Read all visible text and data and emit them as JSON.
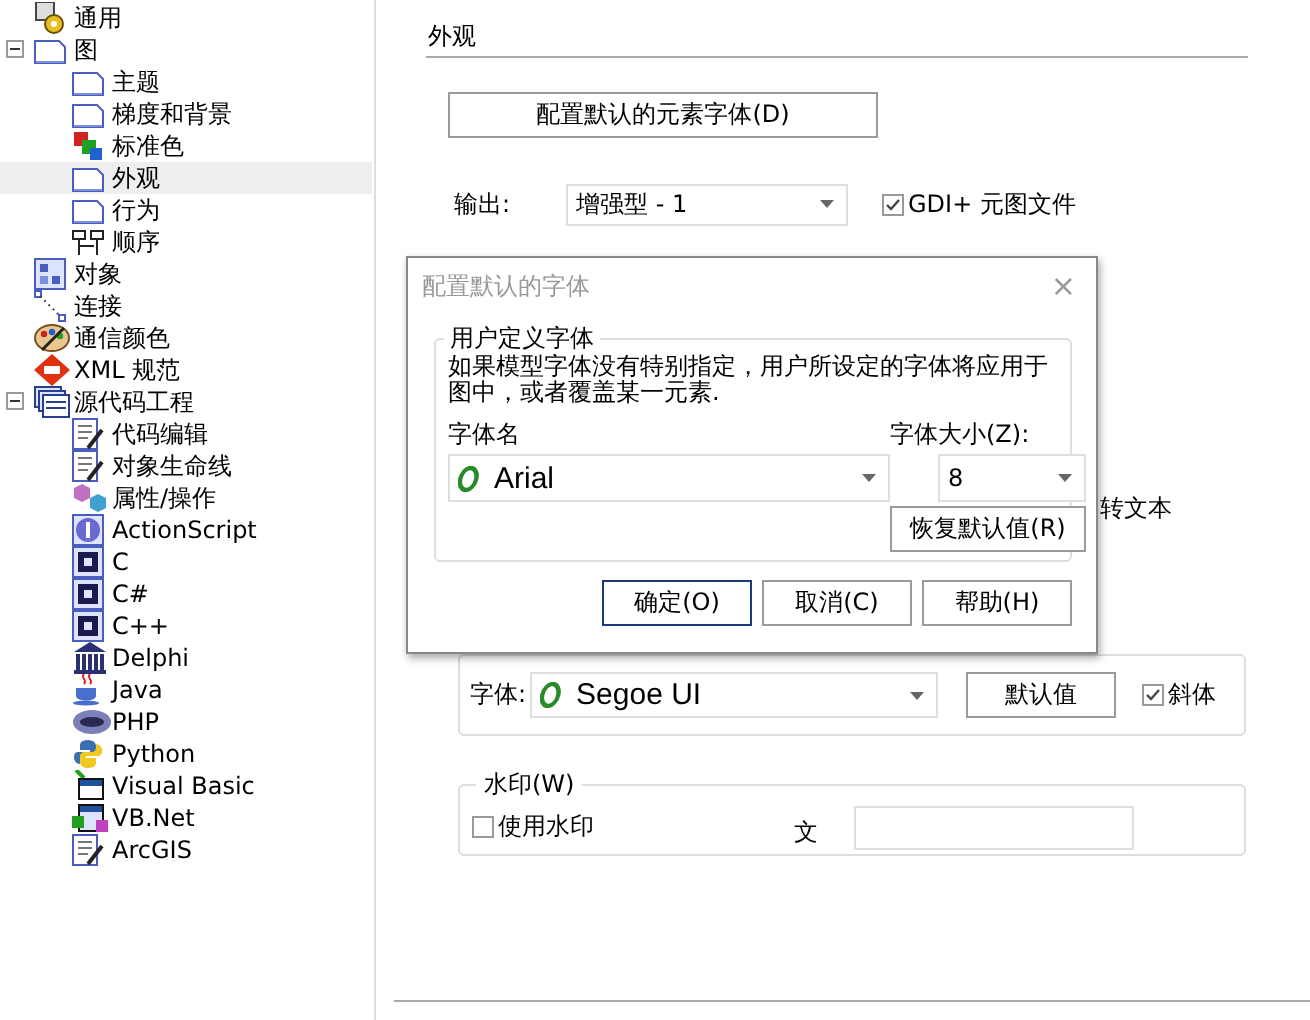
{
  "tree": [
    {
      "label": "通用",
      "selected": false
    },
    {
      "label": "图",
      "selected": false,
      "expanded": true,
      "children": [
        {
          "label": "主题",
          "selected": false
        },
        {
          "label": "梯度和背景",
          "selected": false
        },
        {
          "label": "标准色",
          "selected": false
        },
        {
          "label": "外观",
          "selected": true
        },
        {
          "label": "行为",
          "selected": false
        },
        {
          "label": "顺序",
          "selected": false
        }
      ]
    },
    {
      "label": "对象",
      "selected": false
    },
    {
      "label": "连接",
      "selected": false
    },
    {
      "label": "通信颜色",
      "selected": false
    },
    {
      "label": "XML 规范",
      "selected": false
    },
    {
      "label": "源代码工程",
      "selected": false,
      "expanded": true,
      "children": [
        {
          "label": "代码编辑",
          "selected": false
        },
        {
          "label": "对象生命线",
          "selected": false
        },
        {
          "label": "属性/操作",
          "selected": false
        },
        {
          "label": "ActionScript",
          "selected": false
        },
        {
          "label": "C",
          "selected": false
        },
        {
          "label": "C#",
          "selected": false
        },
        {
          "label": "C++",
          "selected": false
        },
        {
          "label": "Delphi",
          "selected": false
        },
        {
          "label": "Java",
          "selected": false
        },
        {
          "label": "PHP",
          "selected": false
        },
        {
          "label": "Python",
          "selected": false
        },
        {
          "label": "Visual Basic",
          "selected": false
        },
        {
          "label": "VB.Net",
          "selected": false
        },
        {
          "label": "ArcGIS",
          "selected": false
        }
      ]
    }
  ],
  "appearance": {
    "title": "外观",
    "font_button": "配置默认的元素字体(D)",
    "output": {
      "label": "输出:",
      "value": "增强型 - 1"
    },
    "gdi": {
      "label": "GDI+ 元图文件",
      "checked": true
    },
    "partial_text": "转文本",
    "handdrawn": {
      "font_label": "字体:",
      "font_value": "Segoe UI",
      "default_button": "默认值",
      "italic": {
        "label": "斜体",
        "checked": true
      }
    },
    "watermark": {
      "legend": "水印(W)",
      "use": {
        "label": "使用水印",
        "checked": false
      },
      "text_label": "文"
    }
  },
  "dialog": {
    "title": "配置默认的字体",
    "close": "×",
    "group": "用户定义字体",
    "description": "如果模型字体没有特别指定，用户所设定的字体将应用于图中，或者覆盖某一元素.",
    "font_name_label": "字体名",
    "font_name": "Arial",
    "font_size_label": "字体大小(Z):",
    "font_size": "8",
    "reset_button": "恢复默认值(R)",
    "buttons": [
      {
        "label": "确定(O)",
        "default": true
      },
      {
        "label": "取消(C)",
        "default": false
      },
      {
        "label": "帮助(H)",
        "default": false
      }
    ]
  }
}
